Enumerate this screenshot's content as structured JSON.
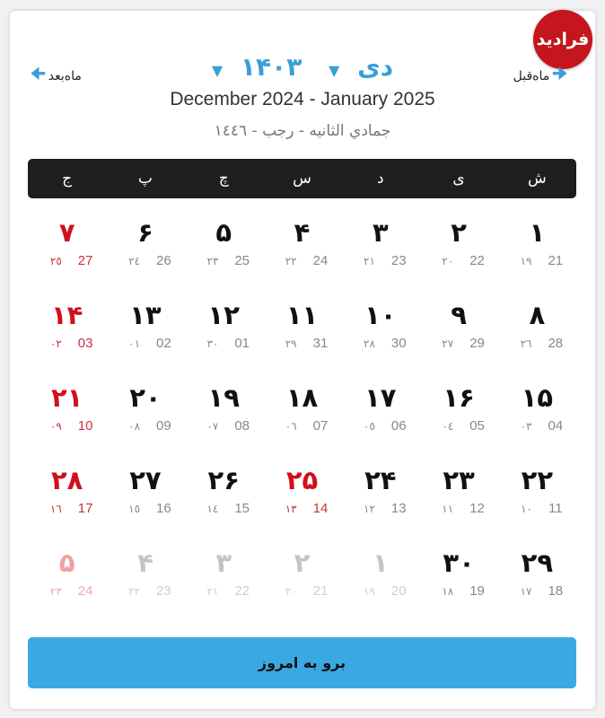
{
  "logo": {
    "text": "فرادید"
  },
  "header": {
    "next_label": "ماه‌بعد",
    "prev_label": "ماه‌قبل",
    "month": "دی",
    "year": "۱۴۰۳",
    "gregorian_range": "December 2024 - January 2025",
    "hijri_range": "جمادي الثانيه - رجب - ١٤٤٦"
  },
  "weekdays": [
    "ش",
    "ی",
    "د",
    "س",
    "چ",
    "پ",
    "ج"
  ],
  "colors": {
    "accent": "#3a9fd8",
    "holiday": "#d0101a",
    "header_bar": "#1e1e1e",
    "button": "#3aa9e2"
  },
  "days": [
    {
      "fa": "۱",
      "g": "21",
      "h": "١٩"
    },
    {
      "fa": "۲",
      "g": "22",
      "h": "٢٠"
    },
    {
      "fa": "۳",
      "g": "23",
      "h": "٢١"
    },
    {
      "fa": "۴",
      "g": "24",
      "h": "٢٢"
    },
    {
      "fa": "۵",
      "g": "25",
      "h": "٢٣"
    },
    {
      "fa": "۶",
      "g": "26",
      "h": "٢٤"
    },
    {
      "fa": "۷",
      "g": "27",
      "h": "٢٥",
      "holiday": true
    },
    {
      "fa": "۸",
      "g": "28",
      "h": "٢٦"
    },
    {
      "fa": "۹",
      "g": "29",
      "h": "٢٧"
    },
    {
      "fa": "۱۰",
      "g": "30",
      "h": "٢٨"
    },
    {
      "fa": "۱۱",
      "g": "31",
      "h": "٢٩"
    },
    {
      "fa": "۱۲",
      "g": "01",
      "h": "٣٠"
    },
    {
      "fa": "۱۳",
      "g": "02",
      "h": "٠١"
    },
    {
      "fa": "۱۴",
      "g": "03",
      "h": "٠٢",
      "holiday": true
    },
    {
      "fa": "۱۵",
      "g": "04",
      "h": "٠٣"
    },
    {
      "fa": "۱۶",
      "g": "05",
      "h": "٠٤"
    },
    {
      "fa": "۱۷",
      "g": "06",
      "h": "٠٥"
    },
    {
      "fa": "۱۸",
      "g": "07",
      "h": "٠٦"
    },
    {
      "fa": "۱۹",
      "g": "08",
      "h": "٠٧"
    },
    {
      "fa": "۲۰",
      "g": "09",
      "h": "٠٨"
    },
    {
      "fa": "۲۱",
      "g": "10",
      "h": "٠٩",
      "holiday": true
    },
    {
      "fa": "۲۲",
      "g": "11",
      "h": "١٠"
    },
    {
      "fa": "۲۳",
      "g": "12",
      "h": "١١"
    },
    {
      "fa": "۲۴",
      "g": "13",
      "h": "١٢"
    },
    {
      "fa": "۲۵",
      "g": "14",
      "h": "١٣",
      "holiday": true
    },
    {
      "fa": "۲۶",
      "g": "15",
      "h": "١٤"
    },
    {
      "fa": "۲۷",
      "g": "16",
      "h": "١٥"
    },
    {
      "fa": "۲۸",
      "g": "17",
      "h": "١٦",
      "holiday": true
    },
    {
      "fa": "۲۹",
      "g": "18",
      "h": "١٧"
    },
    {
      "fa": "۳۰",
      "g": "19",
      "h": "١٨"
    },
    {
      "fa": "۱",
      "g": "20",
      "h": "١٩",
      "other": true
    },
    {
      "fa": "۲",
      "g": "21",
      "h": "٢٠",
      "other": true
    },
    {
      "fa": "۳",
      "g": "22",
      "h": "٢١",
      "other": true
    },
    {
      "fa": "۴",
      "g": "23",
      "h": "٢٢",
      "other": true
    },
    {
      "fa": "۵",
      "g": "24",
      "h": "٢٣",
      "other": true,
      "holiday": true
    }
  ],
  "today_button": "برو به امروز"
}
